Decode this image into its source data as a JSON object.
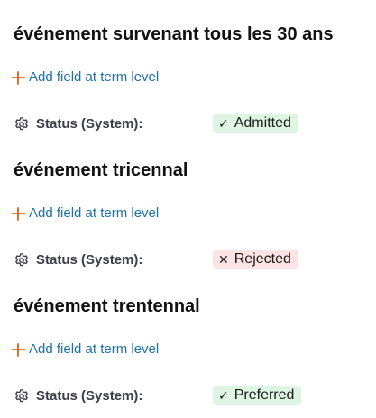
{
  "terms": [
    {
      "title": "événement survenant tous les 30 ans",
      "add_field_label": "Add field at term level",
      "status_label": "Status (System):",
      "status_value": "Admitted",
      "status_icon": "✓"
    },
    {
      "title": "événement tricennal",
      "add_field_label": "Add field at term level",
      "status_label": "Status (System):",
      "status_value": "Rejected",
      "status_icon": "✕"
    },
    {
      "title": "événement trentennal",
      "add_field_label": "Add field at term level",
      "status_label": "Status (System):",
      "status_value": "Preferred",
      "status_icon": "✓"
    }
  ],
  "colors": {
    "accent_plus": "#e0702a",
    "link": "#1f6fa8",
    "badge_good_bg": "#dff5e3",
    "badge_bad_bg": "#fde3e3"
  }
}
